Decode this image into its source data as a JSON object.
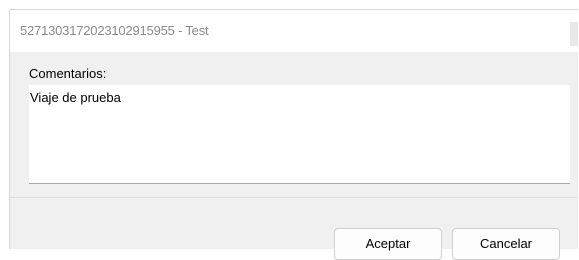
{
  "window": {
    "title": "52713031720231029159​55 - Test"
  },
  "form": {
    "comments_label": "Comentarios:",
    "comments_value": "Viaje de prueba"
  },
  "buttons": {
    "accept_label": "Aceptar",
    "cancel_label": "Cancelar"
  },
  "colors": {
    "dialog_bg": "#f0f0f0",
    "titlebar_bg": "#ffffff",
    "title_text": "#8a8a8a"
  }
}
